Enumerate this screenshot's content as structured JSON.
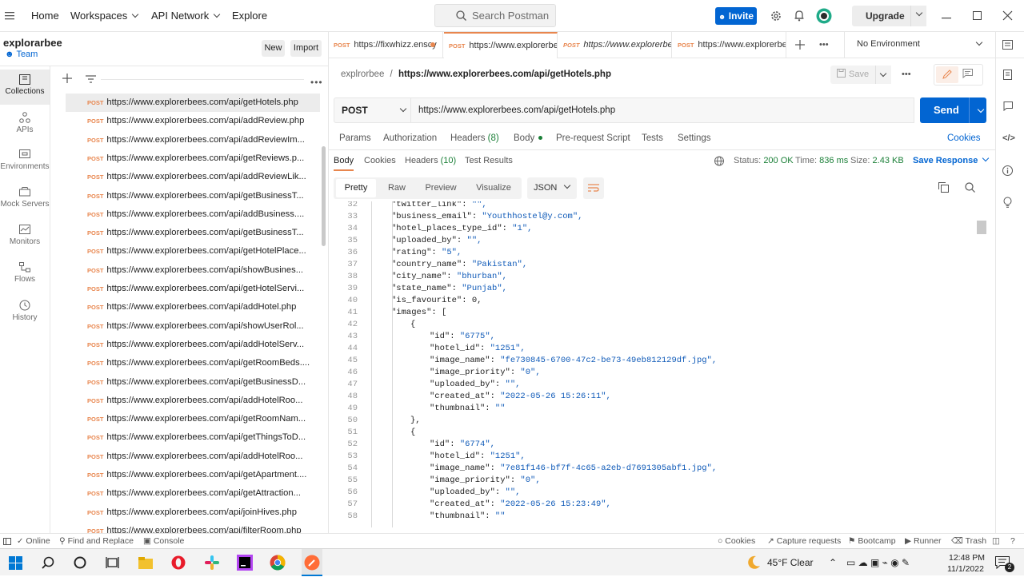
{
  "topbar": {
    "home": "Home",
    "workspaces": "Workspaces",
    "api_network": "API Network",
    "explore": "Explore",
    "search_placeholder": "Search Postman",
    "invite": "Invite",
    "upgrade": "Upgrade"
  },
  "workspace": {
    "name": "explorarbee",
    "team": "Team",
    "new": "New",
    "import": "Import"
  },
  "leftnav": [
    {
      "label": "Collections",
      "icon": "collections-icon"
    },
    {
      "label": "APIs",
      "icon": "apis-icon"
    },
    {
      "label": "Environments",
      "icon": "environments-icon"
    },
    {
      "label": "Mock Servers",
      "icon": "mock-servers-icon"
    },
    {
      "label": "Monitors",
      "icon": "monitors-icon"
    },
    {
      "label": "Flows",
      "icon": "flows-icon"
    },
    {
      "label": "History",
      "icon": "history-icon"
    }
  ],
  "sidebar_items": [
    {
      "method": "POST",
      "url": "https://www.explorerbees.com/api/getHotels.php"
    },
    {
      "method": "POST",
      "url": "https://www.explorerbees.com/api/addReview.php"
    },
    {
      "method": "POST",
      "url": "https://www.explorerbees.com/api/addReviewIm..."
    },
    {
      "method": "POST",
      "url": "https://www.explorerbees.com/api/getReviews.p..."
    },
    {
      "method": "POST",
      "url": "https://www.explorerbees.com/api/addReviewLik..."
    },
    {
      "method": "POST",
      "url": "https://www.explorerbees.com/api/getBusinessT..."
    },
    {
      "method": "POST",
      "url": "https://www.explorerbees.com/api/addBusiness...."
    },
    {
      "method": "POST",
      "url": "https://www.explorerbees.com/api/getBusinessT..."
    },
    {
      "method": "POST",
      "url": "https://www.explorerbees.com/api/getHotelPlace..."
    },
    {
      "method": "POST",
      "url": "https://www.explorerbees.com/api/showBusines..."
    },
    {
      "method": "POST",
      "url": "https://www.explorerbees.com/api/getHotelServi..."
    },
    {
      "method": "POST",
      "url": "https://www.explorerbees.com/api/addHotel.php"
    },
    {
      "method": "POST",
      "url": "https://www.explorerbees.com/api/showUserRol..."
    },
    {
      "method": "POST",
      "url": "https://www.explorerbees.com/api/addHotelServ..."
    },
    {
      "method": "POST",
      "url": "https://www.explorerbees.com/api/getRoomBeds...."
    },
    {
      "method": "POST",
      "url": "https://www.explorerbees.com/api/getBusinessD..."
    },
    {
      "method": "POST",
      "url": "https://www.explorerbees.com/api/addHotelRoo..."
    },
    {
      "method": "POST",
      "url": "https://www.explorerbees.com/api/getRoomNam..."
    },
    {
      "method": "POST",
      "url": "https://www.explorerbees.com/api/getThingsToD..."
    },
    {
      "method": "POST",
      "url": "https://www.explorerbees.com/api/addHotelRoo..."
    },
    {
      "method": "POST",
      "url": "https://www.explorerbees.com/api/getApartment...."
    },
    {
      "method": "POST",
      "url": "https://www.explorerbees.com/api/getAttraction..."
    },
    {
      "method": "POST",
      "url": "https://www.explorerbees.com/api/joinHives.php"
    },
    {
      "method": "POST",
      "url": "https://www.explorerbees.com/api/filterRoom.php"
    }
  ],
  "tabs": [
    {
      "method": "POST",
      "title": "https://fixwhizz.enscy"
    },
    {
      "method": "POST",
      "title": "https://www.explorerbe"
    },
    {
      "method": "POST",
      "title": "https://www.explorerbe"
    },
    {
      "method": "POST",
      "title": "https://www.explorerbe"
    }
  ],
  "environment": "No Environment",
  "breadcrumb": {
    "collection": "explrorbee",
    "separator": "/",
    "request": "https://www.explorerbees.com/api/getHotels.php"
  },
  "save": "Save",
  "request": {
    "method": "POST",
    "url": "https://www.explorerbees.com/api/getHotels.php",
    "send": "Send"
  },
  "request_tabs": {
    "params": "Params",
    "authorization": "Authorization",
    "headers": "Headers",
    "headers_count": "(8)",
    "body": "Body",
    "pre_request": "Pre-request Script",
    "tests": "Tests",
    "settings": "Settings",
    "cookies": "Cookies"
  },
  "response_tabs": {
    "body": "Body",
    "cookies": "Cookies",
    "headers": "Headers",
    "headers_count": "(10)",
    "test_results": "Test Results"
  },
  "response_meta": {
    "status_label": "Status:",
    "status": "200 OK",
    "time_label": "Time:",
    "time": "836 ms",
    "size_label": "Size:",
    "size": "2.43 KB",
    "save_response": "Save Response"
  },
  "view_tabs": {
    "pretty": "Pretty",
    "raw": "Raw",
    "preview": "Preview",
    "visualize": "Visualize",
    "format": "JSON"
  },
  "code_lines": [
    {
      "n": "32",
      "indent": 1,
      "text": "\"twitter_link\": \"\","
    },
    {
      "n": "33",
      "indent": 1,
      "text": "\"business_email\": \"Youthhostel@y.com\","
    },
    {
      "n": "34",
      "indent": 1,
      "text": "\"hotel_places_type_id\": \"1\","
    },
    {
      "n": "35",
      "indent": 1,
      "text": "\"uploaded_by\": \"\","
    },
    {
      "n": "36",
      "indent": 1,
      "text": "\"rating\": \"5\","
    },
    {
      "n": "37",
      "indent": 1,
      "text": "\"country_name\": \"Pakistan\","
    },
    {
      "n": "38",
      "indent": 1,
      "text": "\"city_name\": \"bhurban\","
    },
    {
      "n": "39",
      "indent": 1,
      "text": "\"state_name\": \"Punjab\","
    },
    {
      "n": "40",
      "indent": 1,
      "text": "\"is_favourite\": 0,"
    },
    {
      "n": "41",
      "indent": 1,
      "text": "\"images\": ["
    },
    {
      "n": "42",
      "indent": 2,
      "text": "{"
    },
    {
      "n": "43",
      "indent": 3,
      "text": "\"id\": \"6775\","
    },
    {
      "n": "44",
      "indent": 3,
      "text": "\"hotel_id\": \"1251\","
    },
    {
      "n": "45",
      "indent": 3,
      "text": "\"image_name\": \"fe730845-6700-47c2-be73-49eb812129df.jpg\","
    },
    {
      "n": "46",
      "indent": 3,
      "text": "\"image_priority\": \"0\","
    },
    {
      "n": "47",
      "indent": 3,
      "text": "\"uploaded_by\": \"\","
    },
    {
      "n": "48",
      "indent": 3,
      "text": "\"created_at\": \"2022-05-26 15:26:11\","
    },
    {
      "n": "49",
      "indent": 3,
      "text": "\"thumbnail\": \"\""
    },
    {
      "n": "50",
      "indent": 2,
      "text": "},"
    },
    {
      "n": "51",
      "indent": 2,
      "text": "{"
    },
    {
      "n": "52",
      "indent": 3,
      "text": "\"id\": \"6774\","
    },
    {
      "n": "53",
      "indent": 3,
      "text": "\"hotel_id\": \"1251\","
    },
    {
      "n": "54",
      "indent": 3,
      "text": "\"image_name\": \"7e81f146-bf7f-4c65-a2eb-d7691305abf1.jpg\","
    },
    {
      "n": "55",
      "indent": 3,
      "text": "\"image_priority\": \"0\","
    },
    {
      "n": "56",
      "indent": 3,
      "text": "\"uploaded_by\": \"\","
    },
    {
      "n": "57",
      "indent": 3,
      "text": "\"created_at\": \"2022-05-26 15:23:49\","
    },
    {
      "n": "58",
      "indent": 3,
      "text": "\"thumbnail\": \"\""
    }
  ],
  "footer": {
    "online": "Online",
    "find_replace": "Find and Replace",
    "console": "Console",
    "cookies": "Cookies",
    "capture": "Capture requests",
    "bootcamp": "Bootcamp",
    "runner": "Runner",
    "trash": "Trash"
  },
  "taskbar": {
    "weather": "45°F  Clear",
    "time": "12:48 PM",
    "date": "11/1/2022",
    "notifications": "2"
  },
  "colors": {
    "accent": "#0265d2",
    "post": "#e8864e",
    "string": "#0f5ab8",
    "status_ok": "#1a7f37"
  }
}
